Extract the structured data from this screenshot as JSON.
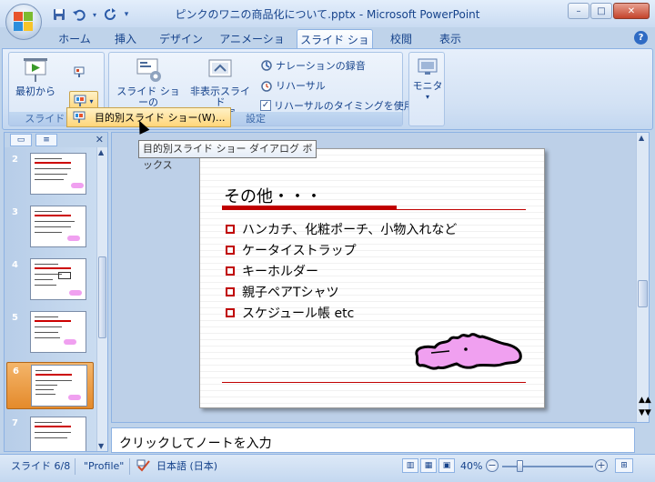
{
  "window": {
    "title": "ピンクのワニの商品化について.pptx - Microsoft PowerPoint",
    "minimize": "–",
    "restore": "□",
    "close": "✕"
  },
  "quick_access": {
    "save_icon": "save-icon",
    "undo_icon": "undo-icon",
    "redo_icon": "redo-icon",
    "customize_icon": "dropdown-icon"
  },
  "tabs": [
    {
      "label": "ホーム",
      "active": false
    },
    {
      "label": "挿入",
      "active": false
    },
    {
      "label": "デザイン",
      "active": false
    },
    {
      "label": "アニメーション",
      "active": false
    },
    {
      "label": "スライド ショー",
      "active": true
    },
    {
      "label": "校閲",
      "active": false
    },
    {
      "label": "表示",
      "active": false
    }
  ],
  "help": "?",
  "ribbon": {
    "group_start": {
      "label": "スライド ショ",
      "from_beginning": "最初から",
      "from_current_icon": "from-current-slide-icon",
      "custom_show_icon": "custom-show-icon"
    },
    "group_setup": {
      "label": "設定",
      "setup_show_line1": "スライド ショーの",
      "setup_show_line2": "設定",
      "hide_slide_line1": "非表示スライド",
      "hide_slide_line2": "に設定",
      "record_narration": "ナレーションの録音",
      "rehearse": "リハーサル",
      "use_timings": "リハーサルのタイミングを使用",
      "use_timings_checked": true
    },
    "group_monitor": {
      "label": "モニタ"
    }
  },
  "dropdown_menu": {
    "item": "目的別スライド ショー(W)..."
  },
  "tooltip": "目的別スライド ショー ダイアログ ボックス",
  "slides_pane": {
    "tab1_icon": "slides-tab-icon",
    "tab2_icon": "outline-tab-icon",
    "close": "✕",
    "thumbnails": [
      {
        "num": "2",
        "selected": false
      },
      {
        "num": "3",
        "selected": false
      },
      {
        "num": "4",
        "selected": false
      },
      {
        "num": "5",
        "selected": false
      },
      {
        "num": "6",
        "selected": true
      },
      {
        "num": "7",
        "selected": false
      }
    ]
  },
  "slide": {
    "title": "その他・・・",
    "bullets": [
      "ハンカチ、化粧ポーチ、小物入れなど",
      "ケータイストラップ",
      "キーホルダー",
      "親子ペアTシャツ",
      "スケジュール帳 etc"
    ],
    "accent_color": "#c00000",
    "mascot_color": "#f0a0f0"
  },
  "notes": {
    "placeholder": "クリックしてノートを入力"
  },
  "status_bar": {
    "slide_info": "スライド 6/8",
    "theme": "\"Profile\"",
    "language": "日本語 (日本)",
    "zoom": "40%",
    "zoom_out": "−",
    "zoom_in": "+"
  }
}
